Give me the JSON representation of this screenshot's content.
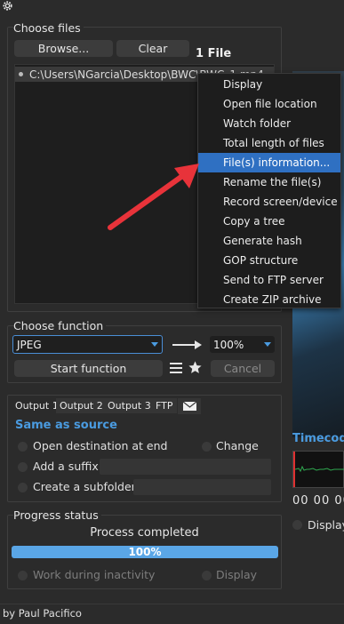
{
  "app": {
    "footer": "by Paul Pacifico"
  },
  "choose_files": {
    "title": "Choose files",
    "browse_label": "Browse...",
    "clear_label": "Clear",
    "count_label": "1 File",
    "files": [
      "C:\\Users\\NGarcia\\Desktop\\BWC\\BWC_1.mp4"
    ]
  },
  "context_menu": {
    "items": [
      "Display",
      "Open file location",
      "Watch folder",
      "Total length of files",
      "File(s) information...",
      "Rename the file(s)",
      "Record screen/device",
      "Copy a tree",
      "Generate hash",
      "GOP structure",
      "Send to FTP server",
      "Create ZIP archive"
    ],
    "selected_index": 4
  },
  "choose_function": {
    "title": "Choose function",
    "function_value": "JPEG",
    "quality_value": "100%",
    "start_label": "Start function",
    "cancel_label": "Cancel"
  },
  "output": {
    "tabs": [
      "Output 1",
      "Output 2",
      "Output 3",
      "FTP"
    ],
    "same_as_source": "Same as source",
    "open_destination": "Open destination at end",
    "change": "Change",
    "add_suffix": "Add a suffix:",
    "create_subfolder": "Create a subfolder:"
  },
  "progress": {
    "title": "Progress status",
    "status": "Process completed",
    "percent_text": "100%",
    "fraction": 1.0,
    "work_during_inactivity": "Work during inactivity",
    "display": "Display"
  },
  "right_panel": {
    "timecode_label": "Timecod",
    "timecode_value": "00 00 00",
    "display_label": "Display"
  },
  "colors": {
    "accent": "#4a9be0",
    "menu_selected": "#2f70c2",
    "arrow": "#e8333a",
    "progress": "#5aa6e6"
  }
}
